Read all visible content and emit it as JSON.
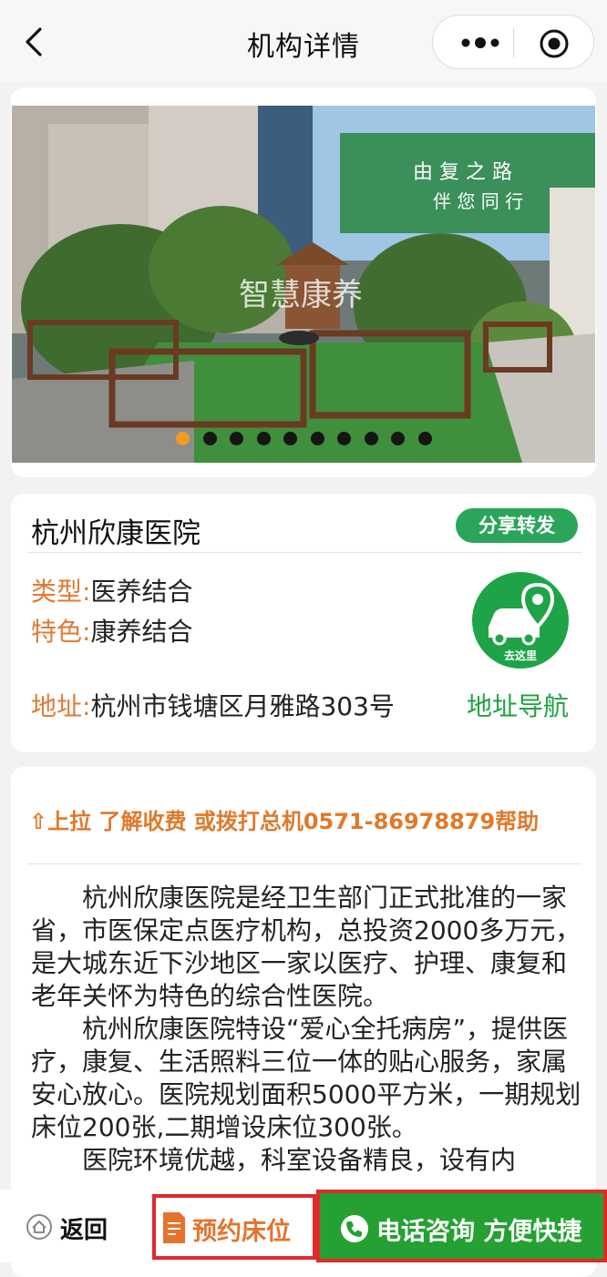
{
  "header": {
    "title": "机构详情",
    "back_icon": "chevron-left-icon",
    "more_icon": "more-dots-icon",
    "target_icon": "target-icon"
  },
  "hero": {
    "watermark": "智慧康养",
    "carousel_count": 10,
    "active_index": 0
  },
  "info": {
    "name": "杭州欣康医院",
    "share_label": "分享转发",
    "type_key": "类型:",
    "type_value": "医养结合",
    "feature_key": "特色:",
    "feature_value": "康养结合",
    "address_key": "地址:",
    "address_value": "杭州市钱塘区月雅路303号",
    "nav_icon_text": "去这里",
    "nav_label": "地址导航"
  },
  "detail": {
    "tip": "⇧上拉 了解收费 或拨打总机0571-86978879帮助",
    "paragraphs": [
      "杭州欣康医院是经卫生部门正式批准的一家省，市医保定点医疗机构，总投资2000多万元，是大城东近下沙地区一家以医疗、护理、康复和老年关怀为特色的综合性医院。",
      "杭州欣康医院特设“爱心全托病房”，提供医疗，康复、生活照料三位一体的贴心服务，家属安心放心。医院规划面积5000平方米，一期规划床位200张,二期增设床位300张。",
      "医院环境优越，科室设备精良，设有内"
    ]
  },
  "bottom_bar": {
    "back_label": "返回",
    "reserve_label": "预约床位",
    "call_label": "电话咨询 方便快捷"
  },
  "colors": {
    "brand_green": "#2aa55a",
    "label_orange": "#e07a35",
    "alert_red": "#e02a2a"
  }
}
